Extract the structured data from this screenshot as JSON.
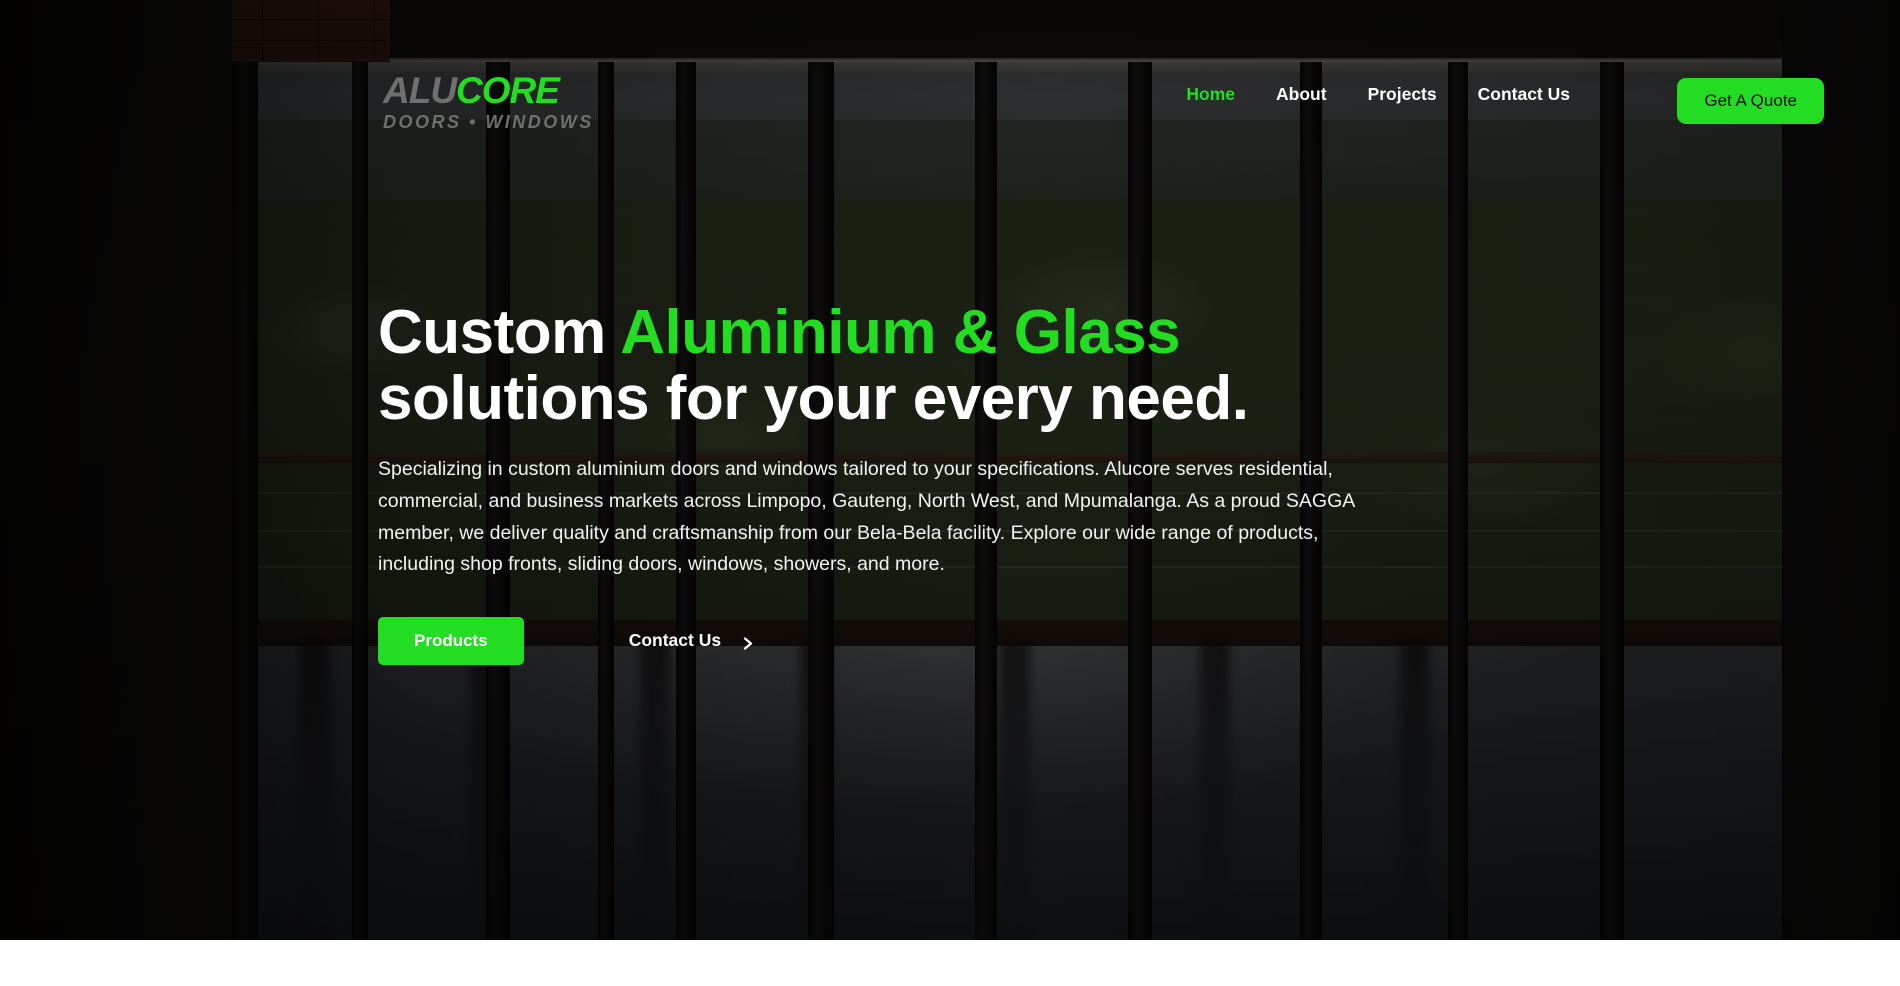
{
  "brand": {
    "logo_primary": "ALU",
    "logo_accent": "CORE",
    "logo_tagline": "DOORS  •  WINDOWS",
    "accent_color": "#22dd22",
    "logo_gray": "#6f6f6f"
  },
  "nav": {
    "items": [
      {
        "label": "Home",
        "active": true
      },
      {
        "label": "About",
        "active": false
      },
      {
        "label": "Projects",
        "active": false
      },
      {
        "label": "Contact Us",
        "active": false
      }
    ],
    "cta_label": "Get A Quote"
  },
  "hero": {
    "headline_line1_plain": "Custom ",
    "headline_line1_accent": "Aluminium & Glass",
    "headline_line2": "solutions for your every need.",
    "paragraph": "Specializing in custom aluminium doors and windows tailored to your specifications. Alucore serves residential, commercial, and business markets across Limpopo, Gauteng, North West, and Mpumalanga. As a proud SAGGA member, we deliver quality and craftsmanship from our Bela-Bela facility. Explore our wide range of products, including shop fronts, sliding doors, windows, showers, and more.",
    "primary_button": "Products",
    "secondary_link": "Contact Us",
    "secondary_icon": "chevron-right-icon"
  }
}
